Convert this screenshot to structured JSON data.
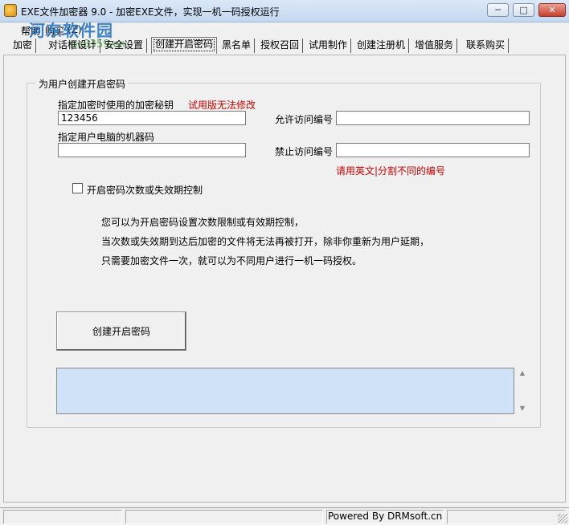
{
  "window": {
    "title": "EXE文件加密器 9.0 - 加密EXE文件，实现一机一码授权运行",
    "minimize_label": "─",
    "maximize_label": "□",
    "close_label": "✕"
  },
  "menu": {
    "items": [
      {
        "label": "帮助"
      },
      {
        "label": "购买"
      },
      {
        "label": "(Z)"
      }
    ]
  },
  "watermark": {
    "text": "河东软件园",
    "url": "pc0359.cn"
  },
  "tabs": [
    {
      "label": "加密"
    },
    {
      "label": "对话框设计"
    },
    {
      "label": "安全设置"
    },
    {
      "label": "创建开启密码"
    },
    {
      "label": "黑名单"
    },
    {
      "label": "授权召回"
    },
    {
      "label": "试用制作"
    },
    {
      "label": "创建注册机"
    },
    {
      "label": "增值服务"
    },
    {
      "label": "联系购买"
    }
  ],
  "group": {
    "title": "为用户创建开启密码",
    "key_label": "指定加密时使用的加密秘钥",
    "trial_warning": "试用版无法修改",
    "key_value": "123456",
    "machine_label": "指定用户电脑的机器码",
    "machine_value": "",
    "allow_label": "允许访问编号",
    "allow_value": "",
    "deny_label": "禁止访问编号",
    "deny_value": "",
    "separator_hint": "请用英文|分割不同的编号",
    "checkbox_label": "开启密码次数或失效期控制",
    "checkbox_checked": false,
    "info_lines": [
      "您可以为开启密码设置次数限制或有效期控制，",
      "当次数或失效期到达后加密的文件将无法再被打开，除非你重新为用户延期，",
      "只需要加密文件一次，就可以为不同用户进行一机一码授权。"
    ],
    "create_button": "创建开启密码",
    "output_value": ""
  },
  "status": {
    "powered_by": "Powered By DRMsoft.cn"
  }
}
